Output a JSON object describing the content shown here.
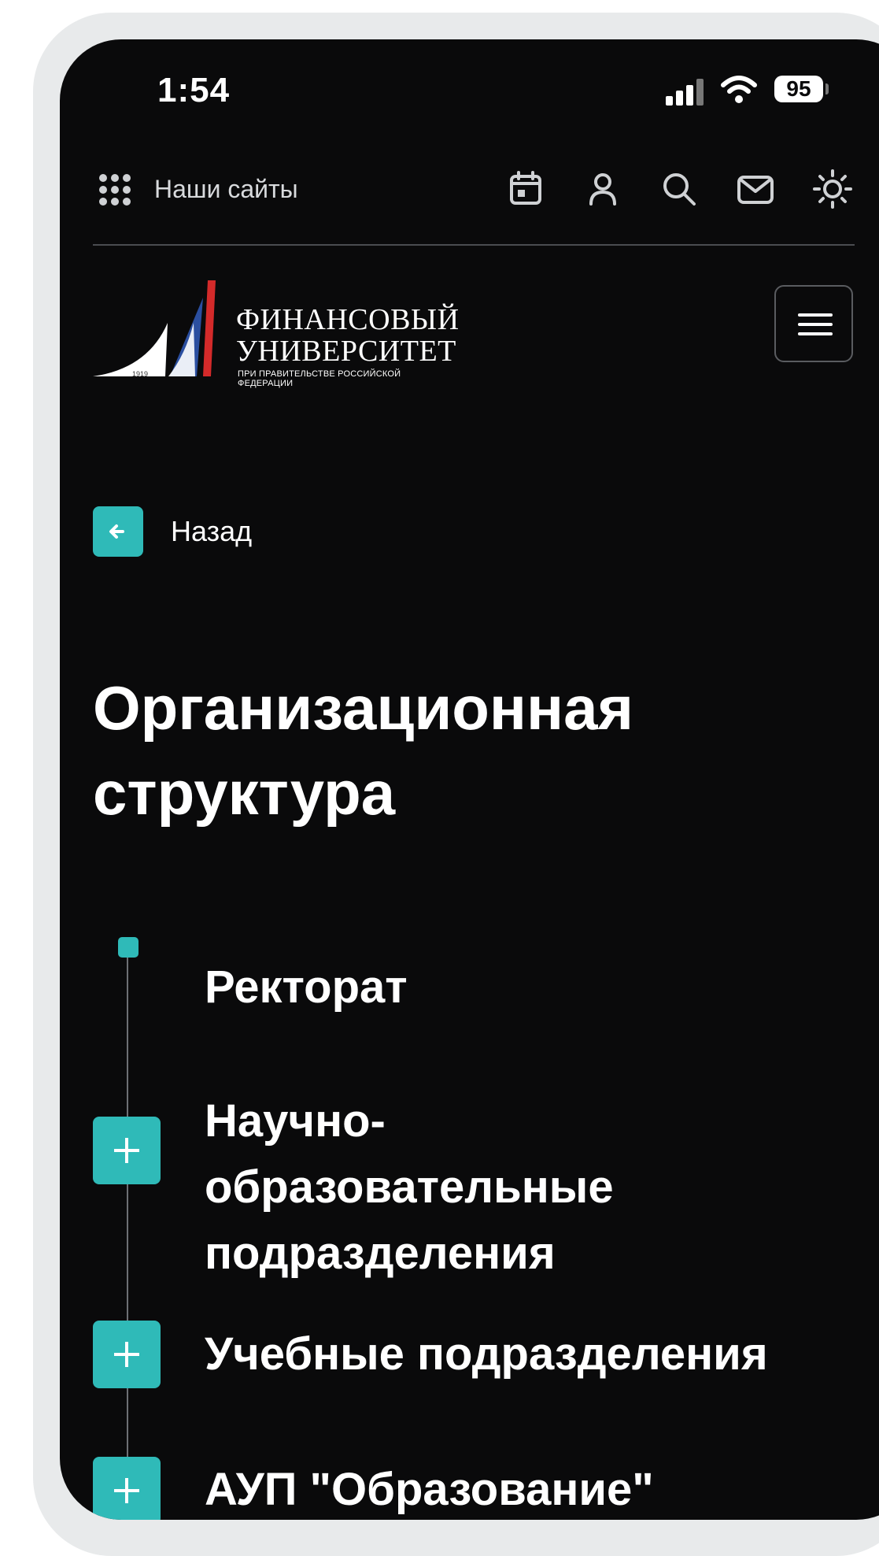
{
  "status_bar": {
    "time": "1:54",
    "battery": "95"
  },
  "topbar": {
    "sites_label": "Наши сайты"
  },
  "logo": {
    "line1": "ФИНАНСОВЫЙ",
    "line2": "УНИВЕРСИТЕТ",
    "line3": "ПРИ ПРАВИТЕЛЬСТВЕ РОССИЙСКОЙ ФЕДЕРАЦИИ",
    "year": "1919"
  },
  "nav": {
    "back_label": "Назад"
  },
  "page": {
    "title": "Организационная структура"
  },
  "tree": {
    "items": [
      {
        "label": "Ректорат"
      },
      {
        "label": "Научно- образовательные подразделения"
      },
      {
        "label": "Учебные подразделения"
      },
      {
        "label": "АУП \"Образование\""
      }
    ]
  },
  "colors": {
    "accent": "#2fbab8",
    "background": "#0a0a0b"
  },
  "icons": [
    "grid-icon",
    "calendar-icon",
    "user-icon",
    "search-icon",
    "mail-icon",
    "sun-icon",
    "menu-icon",
    "arrow-left-icon",
    "plus-icon"
  ]
}
